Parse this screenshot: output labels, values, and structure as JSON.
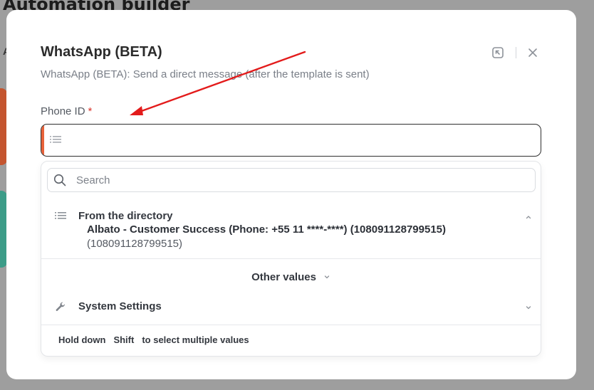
{
  "background": {
    "page_title": "Automation builder",
    "side_letter": "A"
  },
  "modal": {
    "title": "WhatsApp (BETA)",
    "subtitle": "WhatsApp (BETA): Send a direct message (after the template is sent)",
    "header_icons": [
      "expand-icon",
      "close-icon"
    ]
  },
  "field": {
    "label": "Phone ID",
    "required_mark": "*",
    "value": "",
    "icon": "list-icon"
  },
  "dropdown": {
    "search_placeholder": "Search",
    "groups": [
      {
        "label": "From the directory",
        "icon": "list-icon",
        "expanded": true,
        "options": [
          {
            "name": "Albato - Customer Success (Phone: +55 11 ****-****) (108091128799515)",
            "id": "(108091128799515)"
          }
        ]
      }
    ],
    "other_values_label": "Other values",
    "system_settings": {
      "label": "System Settings",
      "icon": "wrench-icon",
      "expanded": false
    },
    "footer": {
      "prefix": "Hold down",
      "key": "Shift",
      "suffix": "to select multiple values"
    }
  },
  "colors": {
    "accent": "#e8623a",
    "required": "#d9342b",
    "annotation_arrow": "#e31b1b"
  }
}
